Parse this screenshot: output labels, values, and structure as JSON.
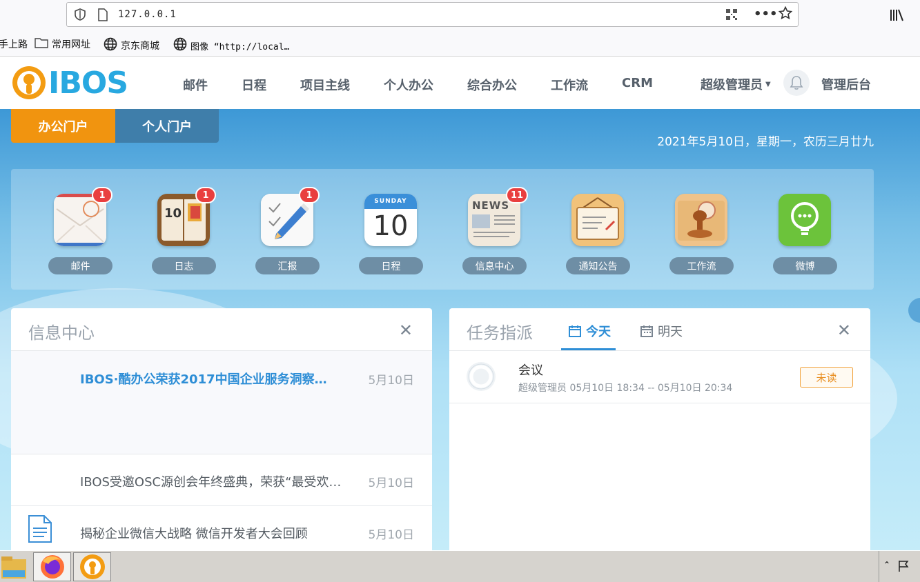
{
  "browser": {
    "url": "127.0.0.1",
    "bookmarks": [
      {
        "label": "手上路",
        "icon": "none"
      },
      {
        "label": "常用网址",
        "icon": "folder-icon"
      },
      {
        "label": "京东商城",
        "icon": "globe-icon"
      },
      {
        "label": "图像 “http://local…",
        "icon": "globe-icon"
      }
    ]
  },
  "header": {
    "logo_text": "IBOS",
    "nav": [
      "邮件",
      "日程",
      "项目主线",
      "个人办公",
      "综合办公",
      "工作流",
      "CRM"
    ],
    "user": "超级管理员",
    "admin": "管理后台"
  },
  "portal": {
    "tabs": [
      "办公门户",
      "个人门户"
    ],
    "date": "2021年5月10日，星期一，农历三月廿九"
  },
  "apps": [
    {
      "label": "邮件",
      "badge": "1",
      "icon": "mail-icon"
    },
    {
      "label": "日志",
      "badge": "1",
      "icon": "diary-icon"
    },
    {
      "label": "汇报",
      "badge": "1",
      "icon": "report-icon"
    },
    {
      "label": "日程",
      "badge": "",
      "icon": "calendar-icon",
      "cal_day": "SUNDAY",
      "cal_num": "10"
    },
    {
      "label": "信息中心",
      "badge": "11",
      "icon": "news-icon",
      "news_word": "NEWS"
    },
    {
      "label": "通知公告",
      "badge": "",
      "icon": "notice-icon"
    },
    {
      "label": "工作流",
      "badge": "",
      "icon": "stamp-icon"
    },
    {
      "label": "微博",
      "badge": "",
      "icon": "weibo-icon"
    }
  ],
  "info_center": {
    "title": "信息中心",
    "items": [
      {
        "title": "IBOS·酷办公荣获2017中国企业服务洞察…",
        "date": "5月10日"
      },
      {
        "title": "IBOS受邀OSC源创会年终盛典，荣获“最受欢迎…",
        "date": "5月10日"
      },
      {
        "title": "揭秘企业微信大战略 微信开发者大会回顾",
        "date": "5月10日"
      }
    ]
  },
  "tasks": {
    "title": "任务指派",
    "tabs": [
      "今天",
      "明天"
    ],
    "items": [
      {
        "title": "会议",
        "meta": "超级管理员 05月10日 18:34 -- 05月10日 20:34",
        "status": "未读"
      }
    ]
  },
  "colors": {
    "accent_orange": "#f1940f",
    "accent_blue": "#2e8ed6",
    "badge_red": "#e93f3f"
  }
}
